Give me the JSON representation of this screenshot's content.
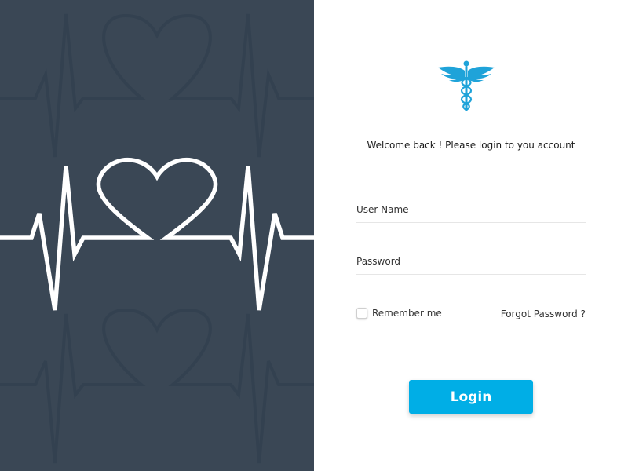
{
  "colors": {
    "left_panel_bg": "#3a4755",
    "accent": "#00aee6",
    "logo_blue": "#1fa3d9",
    "heartbeat_line": "#ffffff",
    "watermark": "#334150"
  },
  "illustration": {
    "main_icon": "heartbeat-heart-icon",
    "watermark_icon": "heartbeat-heart-icon"
  },
  "logo": {
    "icon": "caduceus-icon"
  },
  "login": {
    "welcome": "Welcome back ! Please login to you account",
    "username_placeholder": "User Name",
    "password_placeholder": "Password",
    "remember_label": "Remember me",
    "forgot_label": "Forgot Password ?",
    "button_label": "Login"
  }
}
